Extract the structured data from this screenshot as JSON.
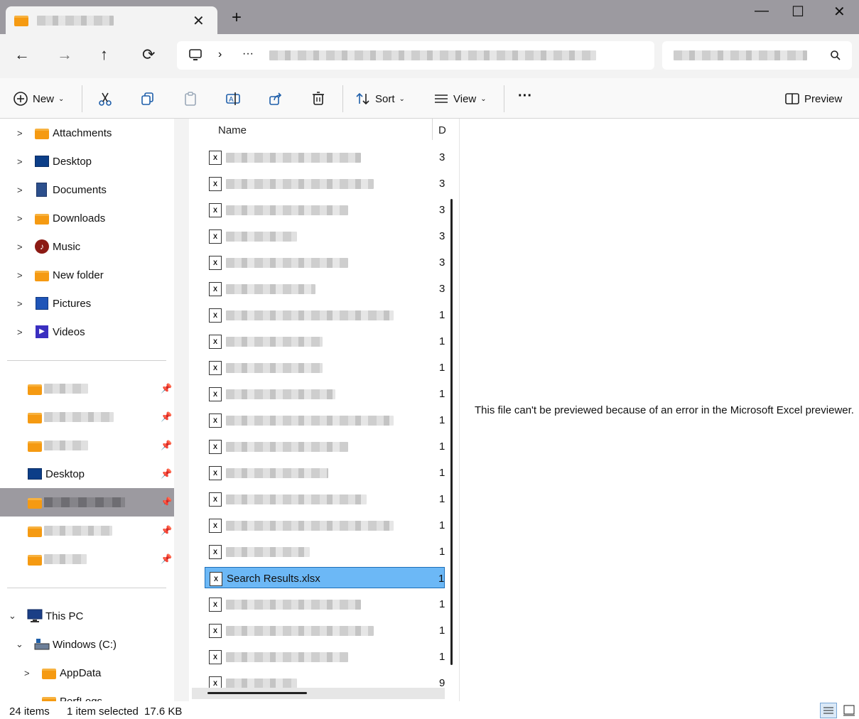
{
  "window": {
    "tab_title": "",
    "controls": {
      "minimize": "—",
      "maximize": "☐",
      "close": "✕"
    },
    "new_tab": "+"
  },
  "nav": {
    "back": "←",
    "forward": "→",
    "up": "↑",
    "refresh": "⟳",
    "breadcrumb_more": "···",
    "address_text": "",
    "search_placeholder": ""
  },
  "toolbar": {
    "new_label": "New",
    "sort_label": "Sort",
    "view_label": "View",
    "more_label": "···",
    "preview_label": "Preview"
  },
  "sidebar": {
    "quick_items": [
      {
        "label": "Attachments",
        "icon": "folder-icon"
      },
      {
        "label": "Desktop",
        "icon": "desktop-icon"
      },
      {
        "label": "Documents",
        "icon": "documents-icon"
      },
      {
        "label": "Downloads",
        "icon": "folder-icon"
      },
      {
        "label": "Music",
        "icon": "music-icon"
      },
      {
        "label": "New folder",
        "icon": "folder-icon"
      },
      {
        "label": "Pictures",
        "icon": "pictures-icon"
      },
      {
        "label": "Videos",
        "icon": "videos-icon"
      }
    ],
    "pinned_desktop": "Desktop",
    "this_pc": "This PC",
    "windows_c": "Windows (C:)",
    "appdata": "AppData",
    "perflogs": "PerfLogs"
  },
  "list": {
    "col_name": "Name",
    "col_date": "D",
    "row_dates": [
      "3",
      "3",
      "3",
      "3",
      "3",
      "3",
      "1",
      "1",
      "1",
      "1",
      "1",
      "1",
      "1",
      "1",
      "1",
      "1",
      "1",
      "1",
      "1",
      "1",
      "9"
    ],
    "selected_name": "Search Results.xlsx",
    "selected_date": "1",
    "xl_glyph": "X"
  },
  "preview": {
    "message": "This file can't be previewed because of an error in the Microsoft Excel previewer."
  },
  "status": {
    "items": "24 items",
    "selected": "1 item selected",
    "size": "17.6 KB"
  }
}
